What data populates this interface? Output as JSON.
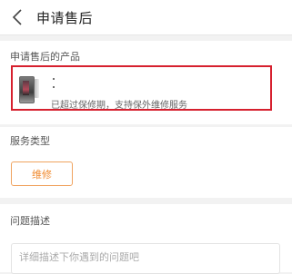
{
  "header": {
    "title": "申请售后",
    "back_icon": "chevron-left-icon"
  },
  "product_section": {
    "title": "申请售后的产品",
    "product": {
      "name": "·",
      "model": "·",
      "warranty_note": "已超过保修期，支持保外维修服务"
    },
    "highlight_color": "#d6202e"
  },
  "service_section": {
    "title": "服务类型",
    "option": "维修",
    "accent_color": "#f08a2e"
  },
  "problem_section": {
    "title": "问题描述",
    "placeholder": "详细描述下你遇到的问题吧"
  }
}
